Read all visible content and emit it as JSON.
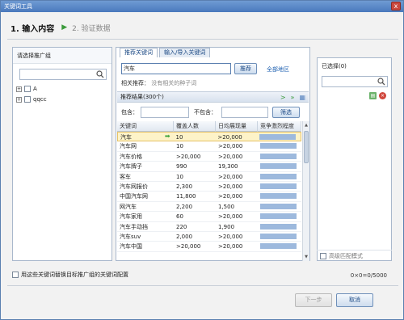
{
  "window": {
    "title": "关键词工具",
    "close_glyph": "x"
  },
  "steps": {
    "step1": "1. 输入内容",
    "step2": "2. 验证数据"
  },
  "left_panel": {
    "header": "请选择推广组",
    "search_placeholder": "",
    "tree": [
      {
        "label": "A"
      },
      {
        "label": "qqcc"
      }
    ]
  },
  "middle_panel": {
    "tabs": [
      "推荐关键词",
      "输入/导入关键词"
    ],
    "keyword_value": "汽车",
    "sort_button": "推荐",
    "all_regions_link": "全部地区",
    "related_label": "相关推荐：",
    "related_value": "没有相关的种子词",
    "results_label": "推荐结果(300个)",
    "include_label": "包含：",
    "exclude_label": "不包含：",
    "filter_button": "筛选",
    "table": {
      "columns": [
        "关键词",
        "覆盖人数",
        "日均展现量",
        "竞争激烈程度"
      ],
      "rows": [
        {
          "kw": "汽车",
          "cov": "10",
          "imp": ">20,000",
          "selected": true
        },
        {
          "kw": "汽车网",
          "cov": "10",
          "imp": ">20,000"
        },
        {
          "kw": "汽车价格",
          "cov": ">20,000",
          "imp": ">20,000"
        },
        {
          "kw": "汽车牌子",
          "cov": "990",
          "imp": "19,300"
        },
        {
          "kw": "客车",
          "cov": "10",
          "imp": ">20,000"
        },
        {
          "kw": "汽车网报价",
          "cov": "2,300",
          "imp": ">20,000"
        },
        {
          "kw": "中国汽车网",
          "cov": "11,800",
          "imp": ">20,000"
        },
        {
          "kw": "网汽车",
          "cov": "2,200",
          "imp": "1,500"
        },
        {
          "kw": "汽车家用",
          "cov": "60",
          "imp": ">20,000"
        },
        {
          "kw": "汽车手动挡",
          "cov": "220",
          "imp": "1,900"
        },
        {
          "kw": "汽车suv",
          "cov": "2,000",
          "imp": ">20,000"
        },
        {
          "kw": "汽车中国",
          "cov": ">20,000",
          "imp": ">20,000"
        }
      ]
    }
  },
  "right_panel": {
    "header": "已选择(0)",
    "fuzzy_label": "高级匹配模式"
  },
  "footer": {
    "replace_label": "用这些关键词替换目标推广组的关键词配置",
    "count": "0×0=0/5000",
    "next_button": "下一步",
    "cancel_button": "取消"
  },
  "colors": {
    "accent": "#1c4a85",
    "title_bar": "#4a79bd",
    "bar": "#9db9dd",
    "selected_row": "#fdf3c8"
  }
}
